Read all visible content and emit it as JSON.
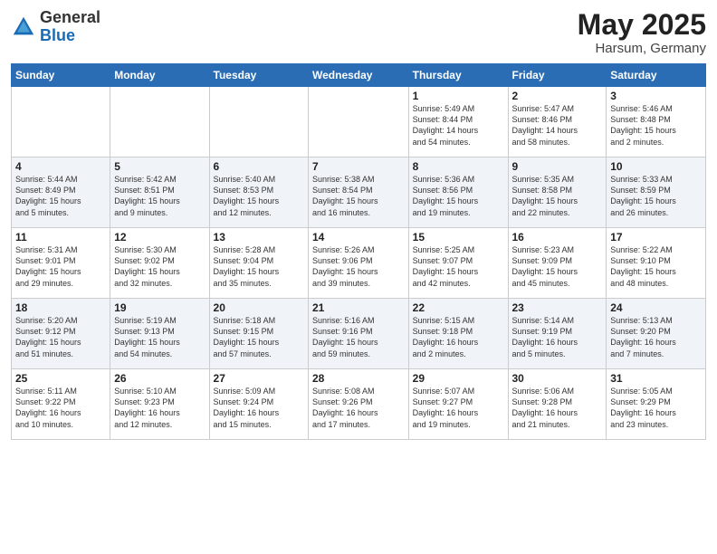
{
  "header": {
    "logo_general": "General",
    "logo_blue": "Blue",
    "month": "May 2025",
    "location": "Harsum, Germany"
  },
  "weekdays": [
    "Sunday",
    "Monday",
    "Tuesday",
    "Wednesday",
    "Thursday",
    "Friday",
    "Saturday"
  ],
  "weeks": [
    [
      {
        "day": "",
        "info": ""
      },
      {
        "day": "",
        "info": ""
      },
      {
        "day": "",
        "info": ""
      },
      {
        "day": "",
        "info": ""
      },
      {
        "day": "1",
        "info": "Sunrise: 5:49 AM\nSunset: 8:44 PM\nDaylight: 14 hours\nand 54 minutes."
      },
      {
        "day": "2",
        "info": "Sunrise: 5:47 AM\nSunset: 8:46 PM\nDaylight: 14 hours\nand 58 minutes."
      },
      {
        "day": "3",
        "info": "Sunrise: 5:46 AM\nSunset: 8:48 PM\nDaylight: 15 hours\nand 2 minutes."
      }
    ],
    [
      {
        "day": "4",
        "info": "Sunrise: 5:44 AM\nSunset: 8:49 PM\nDaylight: 15 hours\nand 5 minutes."
      },
      {
        "day": "5",
        "info": "Sunrise: 5:42 AM\nSunset: 8:51 PM\nDaylight: 15 hours\nand 9 minutes."
      },
      {
        "day": "6",
        "info": "Sunrise: 5:40 AM\nSunset: 8:53 PM\nDaylight: 15 hours\nand 12 minutes."
      },
      {
        "day": "7",
        "info": "Sunrise: 5:38 AM\nSunset: 8:54 PM\nDaylight: 15 hours\nand 16 minutes."
      },
      {
        "day": "8",
        "info": "Sunrise: 5:36 AM\nSunset: 8:56 PM\nDaylight: 15 hours\nand 19 minutes."
      },
      {
        "day": "9",
        "info": "Sunrise: 5:35 AM\nSunset: 8:58 PM\nDaylight: 15 hours\nand 22 minutes."
      },
      {
        "day": "10",
        "info": "Sunrise: 5:33 AM\nSunset: 8:59 PM\nDaylight: 15 hours\nand 26 minutes."
      }
    ],
    [
      {
        "day": "11",
        "info": "Sunrise: 5:31 AM\nSunset: 9:01 PM\nDaylight: 15 hours\nand 29 minutes."
      },
      {
        "day": "12",
        "info": "Sunrise: 5:30 AM\nSunset: 9:02 PM\nDaylight: 15 hours\nand 32 minutes."
      },
      {
        "day": "13",
        "info": "Sunrise: 5:28 AM\nSunset: 9:04 PM\nDaylight: 15 hours\nand 35 minutes."
      },
      {
        "day": "14",
        "info": "Sunrise: 5:26 AM\nSunset: 9:06 PM\nDaylight: 15 hours\nand 39 minutes."
      },
      {
        "day": "15",
        "info": "Sunrise: 5:25 AM\nSunset: 9:07 PM\nDaylight: 15 hours\nand 42 minutes."
      },
      {
        "day": "16",
        "info": "Sunrise: 5:23 AM\nSunset: 9:09 PM\nDaylight: 15 hours\nand 45 minutes."
      },
      {
        "day": "17",
        "info": "Sunrise: 5:22 AM\nSunset: 9:10 PM\nDaylight: 15 hours\nand 48 minutes."
      }
    ],
    [
      {
        "day": "18",
        "info": "Sunrise: 5:20 AM\nSunset: 9:12 PM\nDaylight: 15 hours\nand 51 minutes."
      },
      {
        "day": "19",
        "info": "Sunrise: 5:19 AM\nSunset: 9:13 PM\nDaylight: 15 hours\nand 54 minutes."
      },
      {
        "day": "20",
        "info": "Sunrise: 5:18 AM\nSunset: 9:15 PM\nDaylight: 15 hours\nand 57 minutes."
      },
      {
        "day": "21",
        "info": "Sunrise: 5:16 AM\nSunset: 9:16 PM\nDaylight: 15 hours\nand 59 minutes."
      },
      {
        "day": "22",
        "info": "Sunrise: 5:15 AM\nSunset: 9:18 PM\nDaylight: 16 hours\nand 2 minutes."
      },
      {
        "day": "23",
        "info": "Sunrise: 5:14 AM\nSunset: 9:19 PM\nDaylight: 16 hours\nand 5 minutes."
      },
      {
        "day": "24",
        "info": "Sunrise: 5:13 AM\nSunset: 9:20 PM\nDaylight: 16 hours\nand 7 minutes."
      }
    ],
    [
      {
        "day": "25",
        "info": "Sunrise: 5:11 AM\nSunset: 9:22 PM\nDaylight: 16 hours\nand 10 minutes."
      },
      {
        "day": "26",
        "info": "Sunrise: 5:10 AM\nSunset: 9:23 PM\nDaylight: 16 hours\nand 12 minutes."
      },
      {
        "day": "27",
        "info": "Sunrise: 5:09 AM\nSunset: 9:24 PM\nDaylight: 16 hours\nand 15 minutes."
      },
      {
        "day": "28",
        "info": "Sunrise: 5:08 AM\nSunset: 9:26 PM\nDaylight: 16 hours\nand 17 minutes."
      },
      {
        "day": "29",
        "info": "Sunrise: 5:07 AM\nSunset: 9:27 PM\nDaylight: 16 hours\nand 19 minutes."
      },
      {
        "day": "30",
        "info": "Sunrise: 5:06 AM\nSunset: 9:28 PM\nDaylight: 16 hours\nand 21 minutes."
      },
      {
        "day": "31",
        "info": "Sunrise: 5:05 AM\nSunset: 9:29 PM\nDaylight: 16 hours\nand 23 minutes."
      }
    ]
  ]
}
